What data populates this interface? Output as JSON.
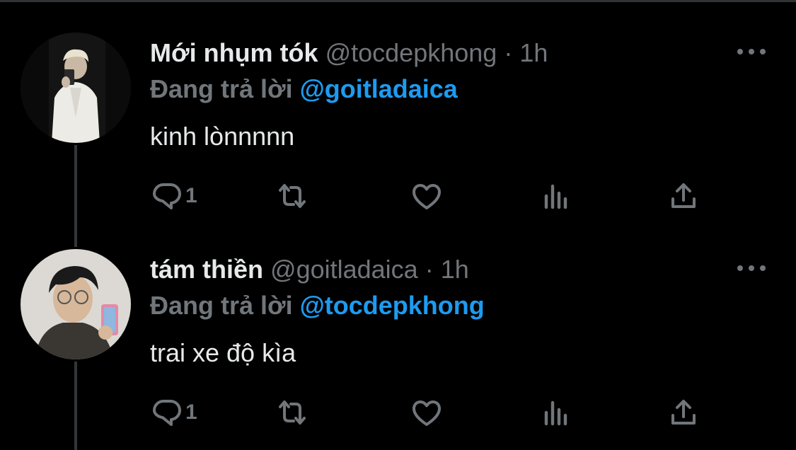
{
  "colors": {
    "background": "#000000",
    "text": "#e7e9ea",
    "secondary": "#71767b",
    "link": "#1d9bf0",
    "thread_line": "#333639"
  },
  "tweets": [
    {
      "display_name": "Mới nhụm tók",
      "handle": "@tocdepkhong",
      "separator": "·",
      "time": "1h",
      "reply_prefix": "Đang trả lời",
      "reply_to": "@goitladaica",
      "text": "kinh lònnnnn",
      "reply_count": "1",
      "icons": [
        "reply-icon",
        "retweet-icon",
        "like-icon",
        "views-icon",
        "share-icon",
        "more-icon"
      ]
    },
    {
      "display_name": "tám thiền",
      "handle": "@goitladaica",
      "separator": "·",
      "time": "1h",
      "reply_prefix": "Đang trả lời",
      "reply_to": "@tocdepkhong",
      "text": "trai xe độ kìa",
      "reply_count": "1",
      "icons": [
        "reply-icon",
        "retweet-icon",
        "like-icon",
        "views-icon",
        "share-icon",
        "more-icon"
      ]
    }
  ]
}
